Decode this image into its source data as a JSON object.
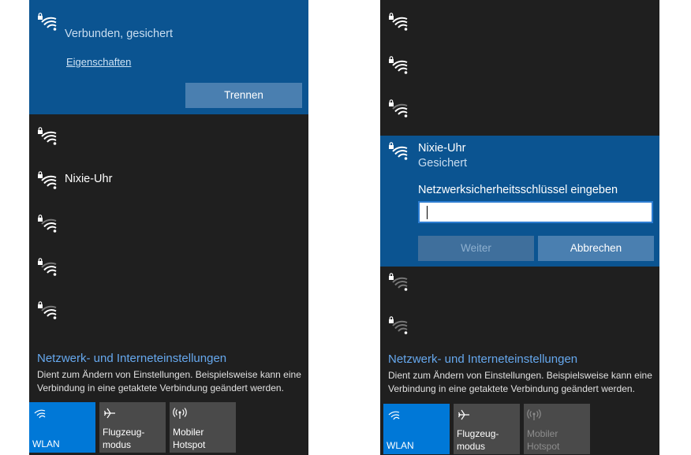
{
  "colors": {
    "panel_bg": "#1f1f1f",
    "accent_expanded": "#0b5491",
    "button": "#4a7fb0",
    "tile_active": "#0078d7",
    "tile_inactive": "#4a4a4a",
    "link_blue": "#66a8ee"
  },
  "left": {
    "connected": {
      "status": "Verbunden, gesichert",
      "properties_link": "Eigenschaften",
      "disconnect_button": "Trennen"
    },
    "networks": [
      {
        "name": ""
      },
      {
        "name": "Nixie-Uhr"
      },
      {
        "name": ""
      },
      {
        "name": ""
      },
      {
        "name": ""
      }
    ],
    "settings": {
      "title": "Netzwerk- und Interneteinstellungen",
      "desc": "Dient zum Ändern von Einstellungen. Beispielsweise kann eine Verbindung in eine getaktete Verbindung geändert werden."
    },
    "tiles": [
      {
        "label": "WLAN",
        "icon": "wifi-icon",
        "active": true
      },
      {
        "label_line1": "Flugzeug-",
        "label_line2": "modus",
        "icon": "airplane-icon"
      },
      {
        "label_line1": "Mobiler",
        "label_line2": "Hotspot",
        "icon": "hotspot-icon"
      }
    ]
  },
  "right": {
    "networks_top": [
      {
        "name": ""
      },
      {
        "name": ""
      },
      {
        "name": ""
      }
    ],
    "selected": {
      "name": "Nixie-Uhr",
      "status": "Gesichert",
      "prompt": "Netzwerksicherheitsschlüssel eingeben",
      "input_value": "",
      "next_button": "Weiter",
      "cancel_button": "Abbrechen"
    },
    "networks_bottom": [
      {
        "name": ""
      },
      {
        "name": ""
      }
    ],
    "settings": {
      "title": "Netzwerk- und Interneteinstellungen",
      "desc": "Dient zum Ändern von Einstellungen. Beispielsweise kann eine Verbindung in eine getaktete Verbindung geändert werden."
    },
    "tiles": [
      {
        "label": "WLAN",
        "icon": "wifi-icon",
        "active": true
      },
      {
        "label_line1": "Flugzeug-",
        "label_line2": "modus",
        "icon": "airplane-icon"
      },
      {
        "label_line1": "Mobiler",
        "label_line2": "Hotspot",
        "icon": "hotspot-icon",
        "disabled": true
      }
    ]
  }
}
